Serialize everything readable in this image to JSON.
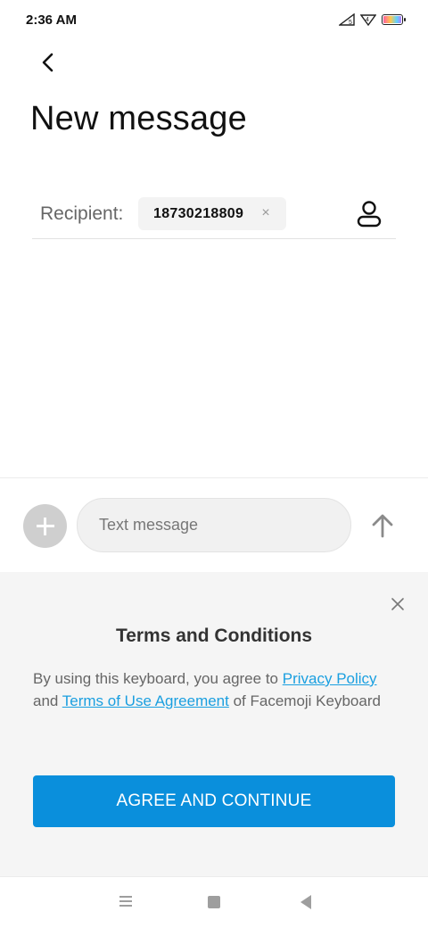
{
  "status_bar": {
    "time": "2:36 AM",
    "icons": [
      "signal-icon",
      "network-icon",
      "battery-icon"
    ]
  },
  "header": {
    "title": "New message",
    "back_icon": "chevron-left-icon"
  },
  "recipient": {
    "label": "Recipient:",
    "chip_value": "18730218809",
    "chip_remove_glyph": "×",
    "contact_icon": "person-icon"
  },
  "compose": {
    "placeholder": "Text message",
    "value": "",
    "attach_icon": "plus-icon",
    "send_icon": "arrow-up-icon"
  },
  "terms": {
    "title": "Terms and Conditions",
    "body_prefix": "By using this keyboard, you agree to ",
    "link_privacy": "Privacy Policy",
    "body_middle": " and ",
    "link_terms": "Terms of Use Agreement",
    "body_suffix": " of Facemoji Keyboard",
    "button_label": "AGREE AND CONTINUE",
    "close_icon": "close-icon"
  },
  "nav_bar": {
    "items": [
      "menu-icon",
      "home-icon",
      "back-icon"
    ]
  },
  "colors": {
    "accent": "#0a8fdc",
    "link": "#1a9fe0",
    "panel_bg": "#f5f5f5"
  }
}
